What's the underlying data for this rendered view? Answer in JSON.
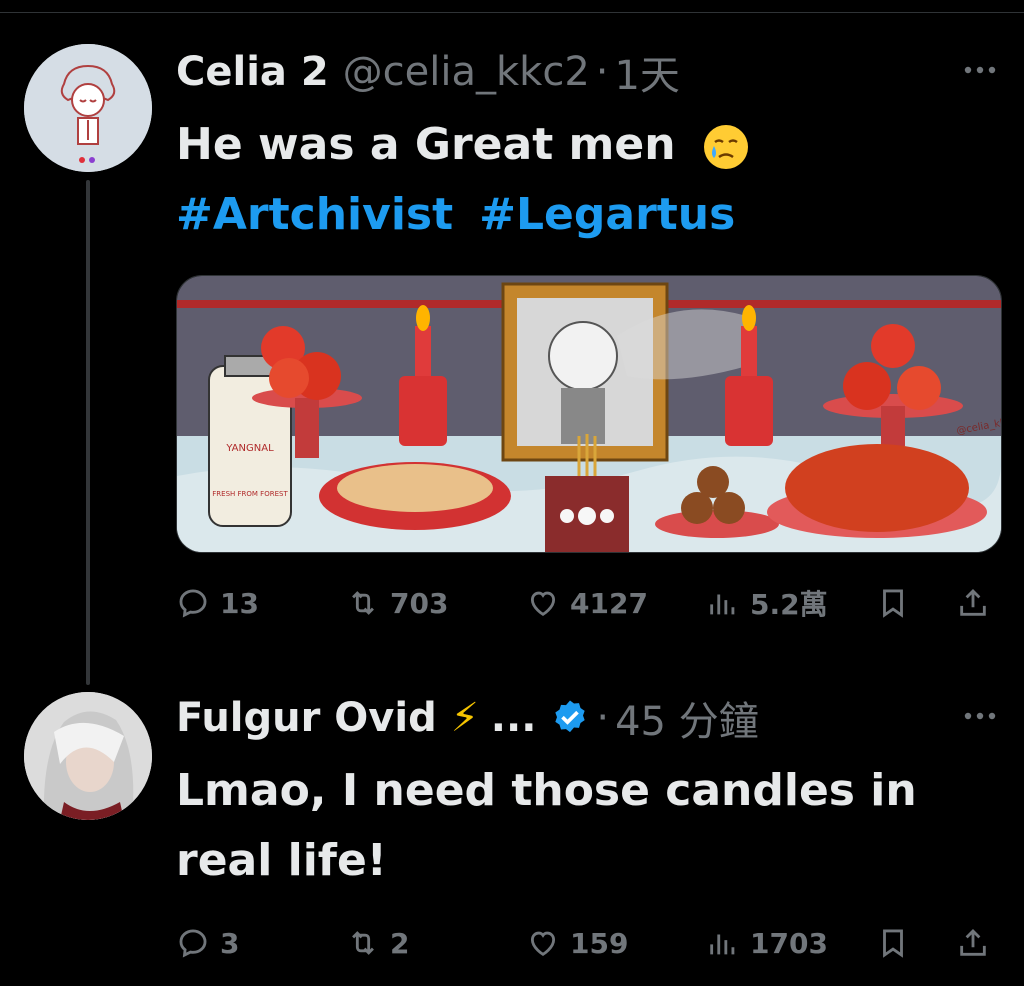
{
  "tweets": [
    {
      "name": "Celia 2",
      "handle": "@celia_kkc2",
      "separator": "·",
      "time": "1天",
      "text": "He was a Great men",
      "emoji": "face-holding-back-tears",
      "hashtags": [
        "#Artchivist",
        "#Legartus"
      ],
      "media": {
        "milk_label": "YANGNAL",
        "milk_sublabel": "FRESH FROM FOREST",
        "signature": "@celia_kkc2"
      },
      "stats": {
        "replies": "13",
        "retweets": "703",
        "likes": "4127",
        "views": "5.2萬"
      }
    },
    {
      "name": "Fulgur Ovid",
      "name_emoji": "⚡",
      "truncation": "...",
      "verified": true,
      "separator": "·",
      "time": "45 分鐘",
      "text": "Lmao, I need those candles in real life!",
      "stats": {
        "replies": "3",
        "retweets": "2",
        "likes": "159",
        "views": "1703"
      }
    }
  ],
  "colors": {
    "background": "#000000",
    "text": "#e7e9ea",
    "muted": "#71767b",
    "link": "#1d9bf0",
    "verified": "#1d9bf0"
  },
  "icons": [
    "reply-icon",
    "retweet-icon",
    "like-icon",
    "views-icon",
    "bookmark-icon",
    "share-icon",
    "more-icon",
    "verified-badge-icon"
  ]
}
